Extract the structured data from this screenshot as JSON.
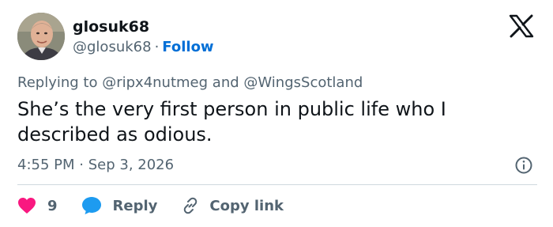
{
  "author": {
    "display_name": "glosuk68",
    "handle": "@glosuk68",
    "follow_label": "Follow"
  },
  "reply_context": {
    "prefix": "Replying to",
    "mentions": [
      "@ripx4nutmeg",
      "@WingsScotland"
    ],
    "joiner": "and"
  },
  "tweet": {
    "text": "She’s the very first person in public life who I described as odious.",
    "time": "4:55 PM",
    "date": "Sep 3, 2026"
  },
  "actions": {
    "like_count": "9",
    "reply_label": "Reply",
    "copy_label": "Copy link"
  },
  "icons": {
    "logo": "x-logo-icon",
    "info": "info-icon",
    "like": "heart-icon",
    "reply": "speech-bubble-icon",
    "copy": "link-icon"
  },
  "colors": {
    "link": "#006fd6",
    "heart": "#f91880",
    "reply": "#1d9bf0",
    "muted": "#536471",
    "text": "#0f1419",
    "divider": "#cfd9de"
  }
}
